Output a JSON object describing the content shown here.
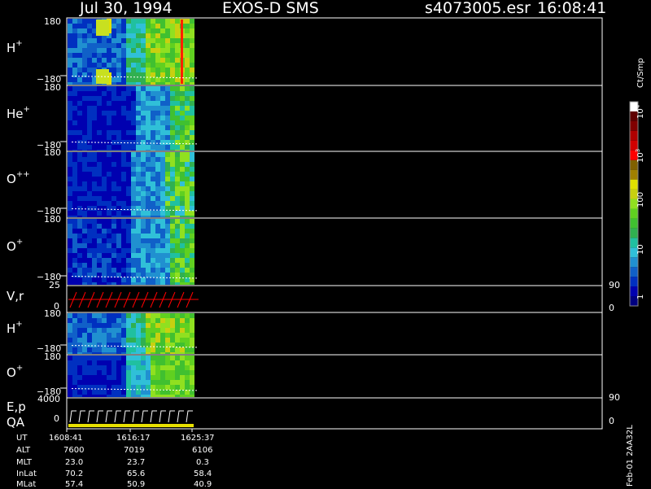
{
  "header": {
    "date": "Jul 30, 1994",
    "instrument": "EXOS-D SMS",
    "file": "s4073005.esr",
    "time": "16:08:41"
  },
  "chart_data": {
    "type": "heatmap",
    "title": "Jul 30, 1994   EXOS-D SMS",
    "colorbar": {
      "label": "Ct/Smp",
      "scale": "log",
      "range": [
        1,
        10000
      ],
      "tick_labels": [
        "1",
        "10",
        "100",
        "10^3",
        "10^4"
      ],
      "colors": [
        "#000080",
        "#0000b0",
        "#0030c0",
        "#1060c8",
        "#2090d0",
        "#30c0d8",
        "#20c0a0",
        "#30b050",
        "#40c030",
        "#60d020",
        "#90e020",
        "#c8d010",
        "#e0e000",
        "#a08000",
        "#806000",
        "#ff0000",
        "#d00000",
        "#b00000",
        "#800000",
        "#600000",
        "#ffffff"
      ]
    },
    "panels": [
      {
        "label": "H",
        "sup": "+",
        "ymax": "180",
        "ymin": "−180"
      },
      {
        "label": "He",
        "sup": "+",
        "ymax": "180",
        "ymin": "−180"
      },
      {
        "label": "O",
        "sup": "++",
        "ymax": "180",
        "ymin": "−180"
      },
      {
        "label": "O",
        "sup": "+",
        "ymax": "180",
        "ymin": "−180"
      },
      {
        "label": "V,r",
        "sup": "",
        "ymax": "25",
        "ymin": "0",
        "right_top": "90",
        "right_bottom": "0"
      },
      {
        "label": "H",
        "sup": "+",
        "ymax": "180",
        "ymin": "−180"
      },
      {
        "label": "O",
        "sup": "+",
        "ymax": "180",
        "ymin": "−180"
      },
      {
        "label": "E,p",
        "label2": "QA",
        "sup": "",
        "ymax": "4000",
        "ymin": "0",
        "right_top": "90",
        "right_bottom": "0"
      }
    ]
  },
  "footer": {
    "times": [
      "1608:41",
      "1616:17",
      "1625:37"
    ],
    "rows": [
      {
        "name": "UT",
        "values": [
          "",
          "",
          ""
        ]
      },
      {
        "name": "ALT",
        "values": [
          "7600",
          "7019",
          "6106"
        ]
      },
      {
        "name": "MLT",
        "values": [
          "23.0",
          "23.7",
          "0.3"
        ]
      },
      {
        "name": "InLat",
        "values": [
          "70.2",
          "65.6",
          "58.4"
        ]
      },
      {
        "name": "MLat",
        "values": [
          "57.4",
          "50.9",
          "40.9"
        ]
      }
    ],
    "stamp": "Feb-01  2AA32L"
  }
}
